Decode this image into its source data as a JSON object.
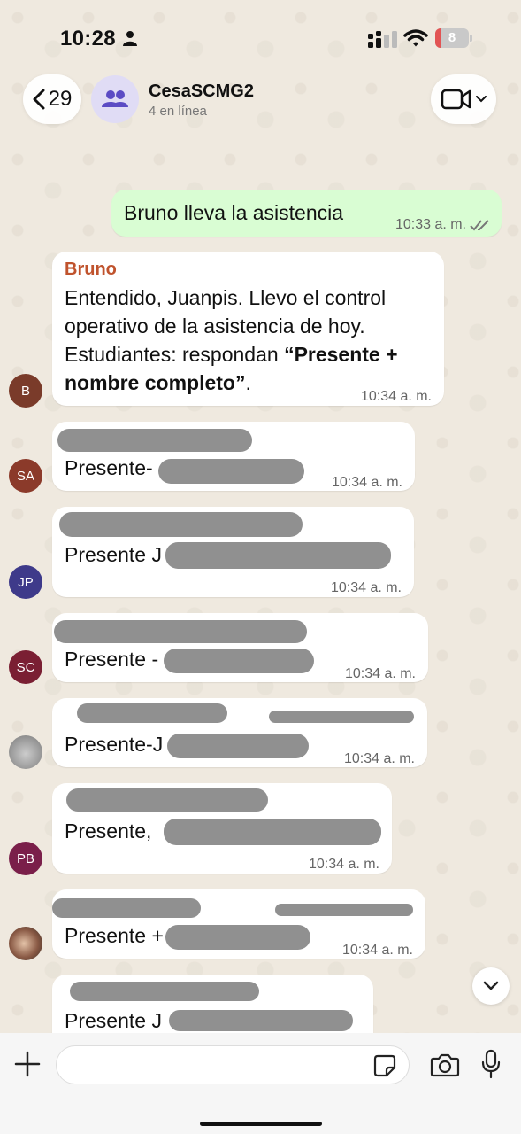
{
  "status_bar": {
    "time": "10:28",
    "battery": "8"
  },
  "header": {
    "back_count": "29",
    "chat_name": "CesaSCMG2",
    "subtitle": "4 en línea"
  },
  "messages": [
    {
      "direction": "out",
      "text": "Bruno lleva la asistencia",
      "time": "10:33 a. m.",
      "status": "read"
    },
    {
      "direction": "in",
      "sender": "Bruno",
      "sender_color": "#c0532d",
      "avatar": "B",
      "avatar_color": "#7a3b2a",
      "text_1": "Entendido, Juanpis. Llevo el control\noperativo de la asistencia de hoy.\nEstudiantes: respondan ",
      "text_bold": "“Presente +\nnombre completo”",
      "text_2": ".",
      "time": "10:34 a. m."
    },
    {
      "direction": "in",
      "avatar": "SA",
      "avatar_color": "#8b3a2a",
      "text": "Presente-",
      "time": "10:34 a. m."
    },
    {
      "direction": "in",
      "avatar": "JP",
      "avatar_color": "#3e3a8a",
      "text": "Presente J",
      "time": "10:34 a. m."
    },
    {
      "direction": "in",
      "avatar": "SC",
      "avatar_color": "#7a1f33",
      "text": "Presente -",
      "time": "10:34 a. m."
    },
    {
      "direction": "in",
      "avatar": "photo",
      "text": "Presente-J",
      "time": "10:34 a. m."
    },
    {
      "direction": "in",
      "avatar": "PB",
      "avatar_color": "#7a1f4a",
      "text": "Presente,",
      "time": "10:34 a. m."
    },
    {
      "direction": "in",
      "avatar": "photo",
      "text": "Presente +",
      "time": "10:34 a. m."
    },
    {
      "direction": "in",
      "text": "Presente J",
      "time": ""
    }
  ],
  "composer": {
    "placeholder": ""
  },
  "colors": {
    "accent": "#d9fdd3",
    "background": "#efe9df"
  },
  "icons": [
    "person-icon",
    "signal-icon",
    "wifi-icon",
    "battery-icon",
    "chevron-left-icon",
    "group-icon",
    "video-camera-icon",
    "chevron-down-icon",
    "plus-icon",
    "sticker-icon",
    "camera-icon",
    "microphone-icon",
    "double-check-icon"
  ]
}
